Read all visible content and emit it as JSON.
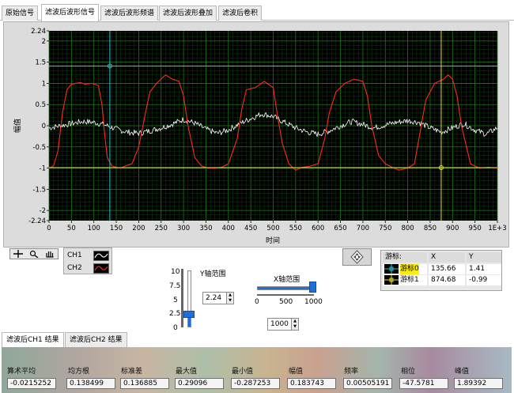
{
  "tabs": [
    "原始信号",
    "滤波后波形信号",
    "滤波后波形频谱",
    "滤波后波形叠加",
    "滤波后卷积"
  ],
  "active_tab": 1,
  "chart_data": {
    "type": "line",
    "xlabel": "时间",
    "ylabel": "幅值",
    "xlim": [
      0,
      1000
    ],
    "ylim": [
      -2.24,
      2.24
    ],
    "x_ticks": [
      "0",
      "50",
      "100",
      "150",
      "200",
      "250",
      "300",
      "350",
      "400",
      "450",
      "500",
      "550",
      "600",
      "650",
      "700",
      "750",
      "800",
      "850",
      "900",
      "950",
      "1E+3"
    ],
    "y_ticks": [
      "2.24",
      "2",
      "1.5",
      "1",
      "0.5",
      "0",
      "-0.5",
      "-1",
      "-1.5",
      "-2",
      "-2.24"
    ],
    "y_tick_values": [
      2.24,
      2,
      1.5,
      1,
      0.5,
      0,
      -0.5,
      -1,
      -1.5,
      -2,
      -2.24
    ],
    "grid": true,
    "series": [
      {
        "name": "CH1",
        "color": "#ffffff",
        "x": [
          0,
          25,
          50,
          75,
          100,
          125,
          150,
          175,
          200,
          225,
          250,
          275,
          300,
          325,
          350,
          375,
          400,
          425,
          450,
          475,
          500,
          525,
          550,
          575,
          600,
          625,
          650,
          675,
          700,
          725,
          750,
          775,
          800,
          825,
          850,
          875,
          900,
          925,
          950,
          975,
          1000
        ],
        "y": [
          -0.05,
          0.0,
          0.05,
          0.1,
          0.08,
          0.02,
          -0.08,
          -0.15,
          -0.18,
          -0.12,
          -0.05,
          0.04,
          0.15,
          0.06,
          -0.08,
          -0.18,
          -0.1,
          0.05,
          0.17,
          0.28,
          0.22,
          0.08,
          -0.05,
          -0.15,
          -0.2,
          -0.12,
          0.0,
          0.1,
          0.03,
          -0.05,
          0.02,
          0.08,
          0.12,
          0.08,
          -0.05,
          -0.15,
          -0.05,
          0.05,
          -0.1,
          -0.2,
          -0.05
        ]
      },
      {
        "name": "CH2",
        "color": "#ff2a1a",
        "x": [
          0,
          10,
          20,
          30,
          40,
          50,
          60,
          70,
          80,
          95,
          110,
          118,
          125,
          130,
          140,
          150,
          160,
          170,
          185,
          200,
          215,
          225,
          240,
          260,
          275,
          290,
          300,
          310,
          325,
          340,
          355,
          370,
          385,
          400,
          420,
          430,
          440,
          460,
          480,
          500,
          510,
          520,
          535,
          550,
          565,
          580,
          600,
          615,
          625,
          640,
          660,
          680,
          700,
          710,
          720,
          735,
          750,
          765,
          780,
          800,
          815,
          825,
          840,
          860,
          880,
          890,
          900,
          910,
          920,
          940,
          960,
          980,
          1000
        ],
        "y": [
          -1.0,
          -0.95,
          -0.6,
          0.3,
          0.85,
          0.98,
          1.0,
          1.02,
          0.98,
          1.0,
          0.95,
          0.5,
          -0.3,
          -0.75,
          -0.95,
          -0.98,
          -1.0,
          -0.95,
          -0.9,
          -0.5,
          0.3,
          0.8,
          1.0,
          1.2,
          1.1,
          1.05,
          0.7,
          0.0,
          -0.75,
          -0.95,
          -1.0,
          -1.0,
          -0.98,
          -0.9,
          -0.3,
          0.4,
          0.85,
          0.9,
          1.05,
          0.9,
          0.2,
          -0.4,
          -0.9,
          -1.05,
          -0.98,
          -0.96,
          -0.9,
          -0.3,
          0.3,
          0.8,
          1.0,
          1.1,
          1.05,
          0.7,
          0.0,
          -0.7,
          -0.9,
          -0.98,
          -1.05,
          -1.0,
          -0.9,
          -0.3,
          0.6,
          1.0,
          1.1,
          1.2,
          1.1,
          0.7,
          0.0,
          -0.9,
          -1.0,
          -0.98,
          -1.0
        ]
      }
    ],
    "cursors": [
      {
        "name": "游标0",
        "x": 135.66,
        "y": 1.41,
        "color": "#2fc7c7"
      },
      {
        "name": "游标1",
        "x": 874.68,
        "y": -0.99,
        "color": "#f0e020"
      }
    ]
  },
  "legend": {
    "ch1": "CH1",
    "ch2": "CH2"
  },
  "cursor_table": {
    "title": "游标:",
    "col_x": "X",
    "col_y": "Y",
    "rows": [
      {
        "name": "游标0",
        "x": "135.66",
        "y": "1.41"
      },
      {
        "name": "游标1",
        "x": "874.68",
        "y": "-0.99"
      }
    ]
  },
  "y_range": {
    "label": "Y轴范围",
    "ticks": [
      "10",
      "7.5",
      "5",
      "2.5",
      "0"
    ],
    "value": "2.24",
    "level": 2.24,
    "max": 10
  },
  "x_range": {
    "label": "X轴范围",
    "ticks": [
      "0",
      "500",
      "1000"
    ],
    "value": "1000",
    "level": 1000,
    "max": 1000
  },
  "result_tabs": [
    "滤波后CH1 结果",
    "滤波后CH2 结果"
  ],
  "results": {
    "labels": [
      "算术平均",
      "均方根",
      "标准差",
      "最大值",
      "最小值",
      "幅值",
      "频率",
      "相位",
      "峰值"
    ],
    "values": [
      "-0.0215252",
      "0.138499",
      "0.136885",
      "0.29096",
      "-0.287253",
      "0.183743",
      "0.00505191",
      "-47.5781",
      "1.89392"
    ]
  }
}
